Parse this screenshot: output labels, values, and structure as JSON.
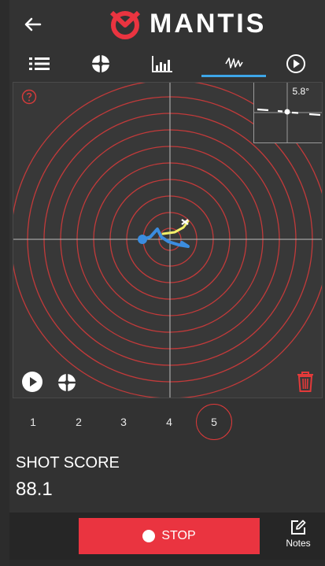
{
  "colors": {
    "accent_red": "#ea3440",
    "tab_active": "#3ea6e8",
    "ring": "#c23a3a",
    "trace_blue": "#3b8de0",
    "trace_yellow": "#f2ef6a"
  },
  "header": {
    "back_icon": "arrow-left-icon",
    "logo_text": "MANTIS",
    "logo_icon": "mantis-logo-icon"
  },
  "tabs": [
    {
      "name": "list",
      "icon": "list-icon"
    },
    {
      "name": "reticle",
      "icon": "reticle-icon"
    },
    {
      "name": "stats",
      "icon": "bar-chart-icon"
    },
    {
      "name": "trace",
      "icon": "trace-squiggle-icon",
      "active": true
    },
    {
      "name": "replay",
      "icon": "play-circle-icon"
    }
  ],
  "target": {
    "inset_label": "5.8°",
    "help_icon": "question-circle-icon",
    "play_icon": "play-circle-icon",
    "reticle_icon": "reticle-icon",
    "trash_icon": "trash-icon"
  },
  "shots": [
    "1",
    "2",
    "3",
    "4",
    "5"
  ],
  "selected_shot": "5",
  "score": {
    "label": "SHOT SCORE",
    "value": "88.1"
  },
  "bottom": {
    "stop_label": "STOP",
    "notes_label": "Notes",
    "notes_icon": "notes-edit-icon"
  }
}
